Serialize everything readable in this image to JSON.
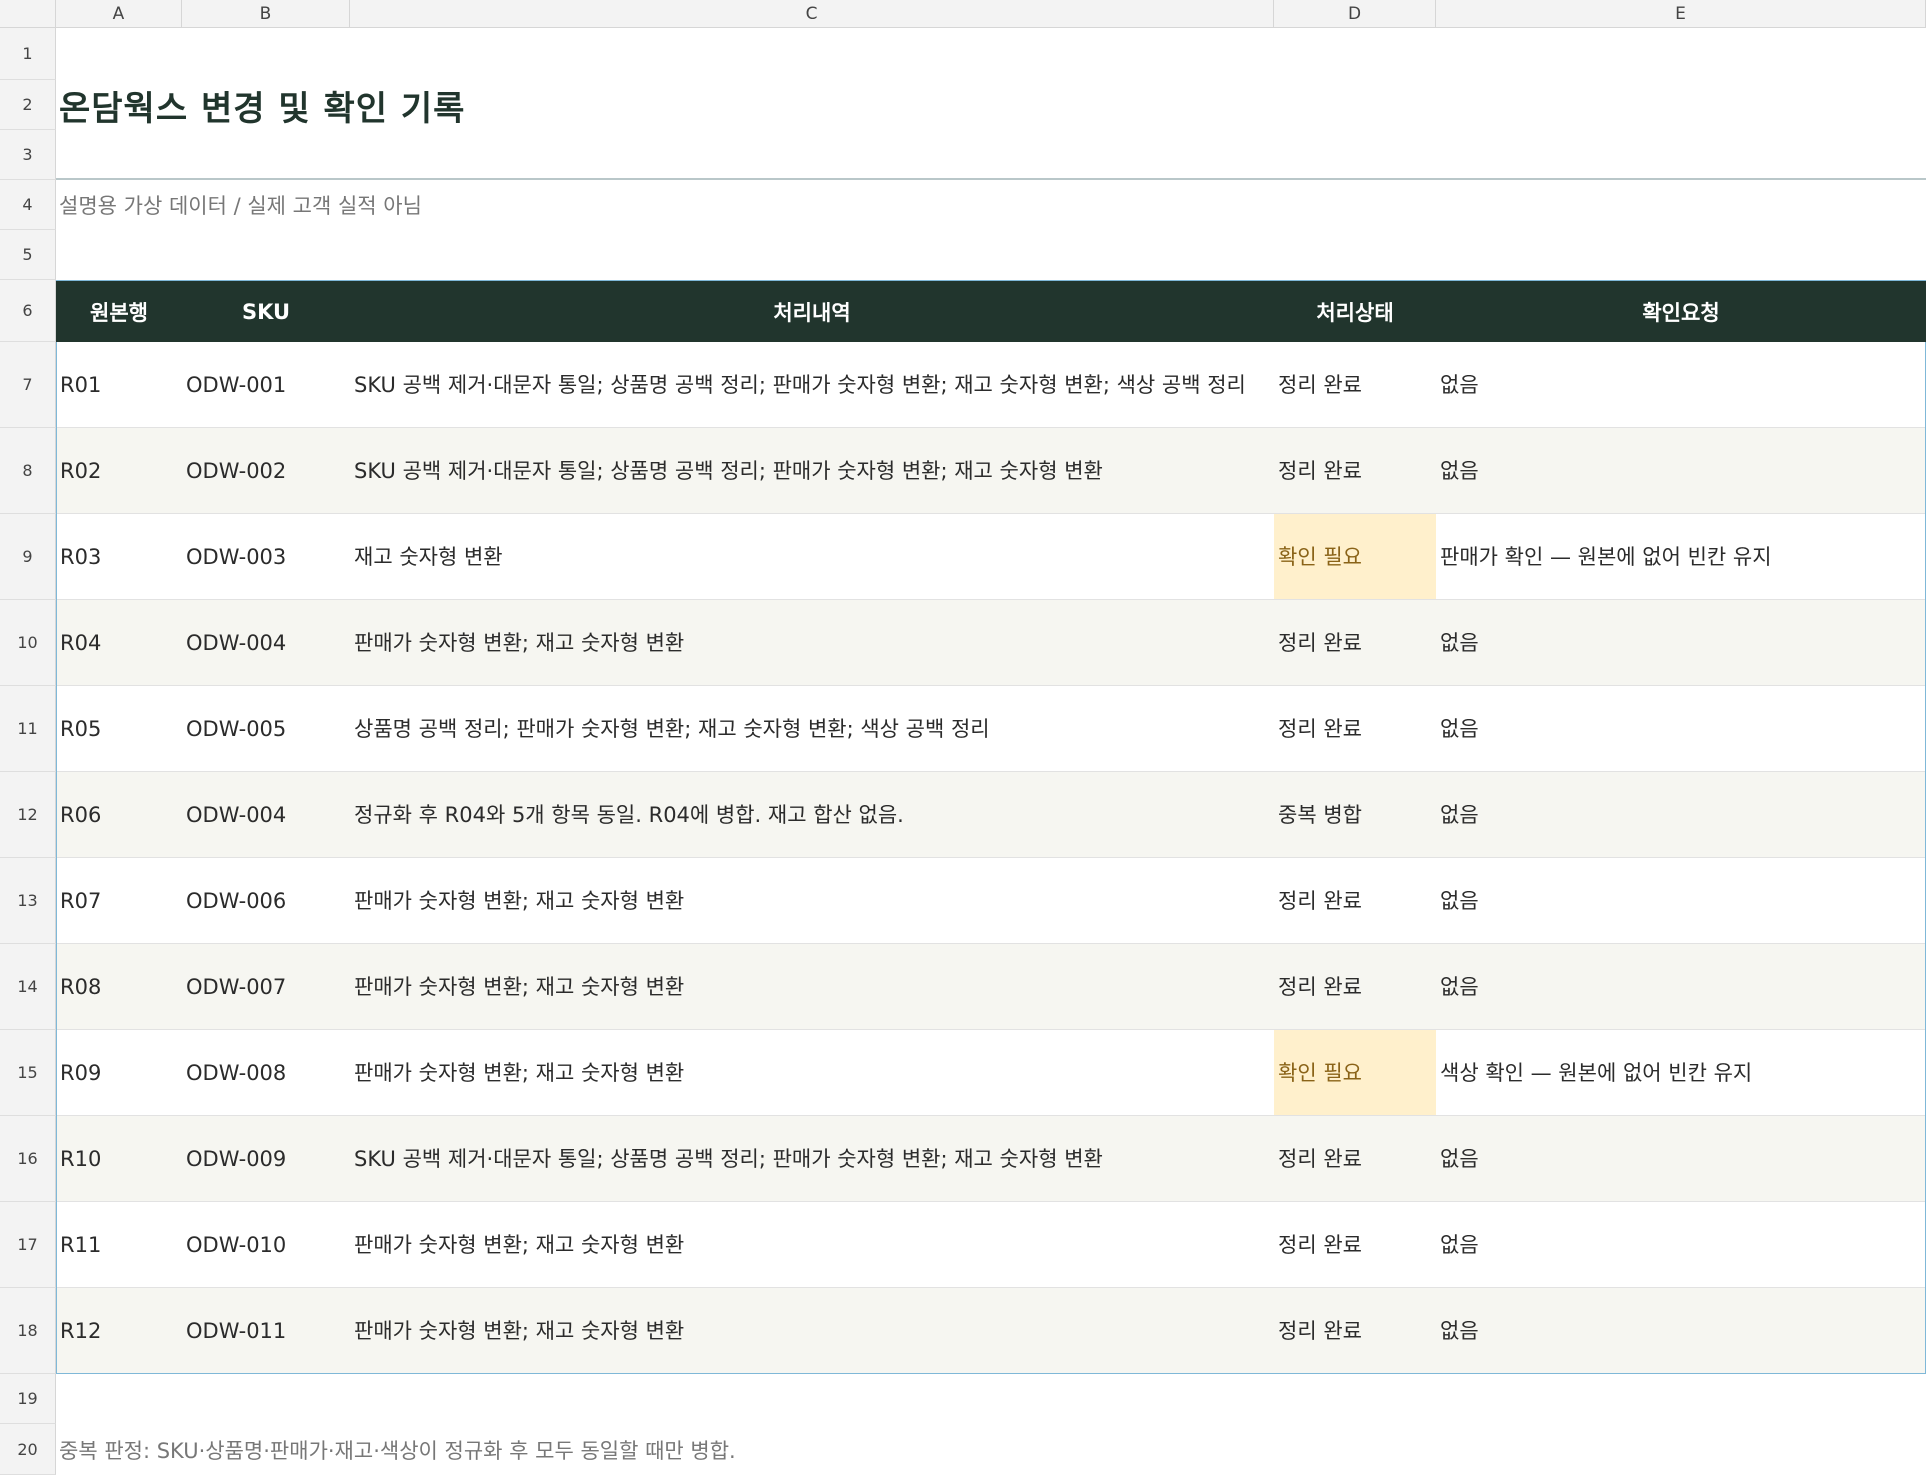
{
  "sheet": {
    "columns": [
      "A",
      "B",
      "C",
      "D",
      "E"
    ],
    "row_numbers": [
      "1",
      "2",
      "3",
      "4",
      "5",
      "6",
      "7",
      "8",
      "9",
      "10",
      "11",
      "12",
      "13",
      "14",
      "15",
      "16",
      "17",
      "18",
      "19",
      "20"
    ],
    "title": "온담웍스  변경 및 확인 기록",
    "subtitle": "설명용 가상 데이터 / 실제 고객 실적 아님",
    "footnote": "중복 판정: SKU·상품명·판매가·재고·색상이 정규화 후 모두 동일할 때만 병합."
  },
  "table": {
    "headers": [
      "원본행",
      "SKU",
      "처리내역",
      "처리상태",
      "확인요청"
    ],
    "header_bg": "#21352d",
    "warn_bg": "#fff0cc",
    "rows": [
      {
        "row": "R01",
        "sku": "ODW-001",
        "detail": "SKU 공백 제거·대문자 통일; 상품명 공백 정리; 판매가 숫자형 변환; 재고 숫자형 변환; 색상 공백 정리",
        "status": "정리 완료",
        "request": "없음"
      },
      {
        "row": "R02",
        "sku": "ODW-002",
        "detail": "SKU 공백 제거·대문자 통일; 상품명 공백 정리; 판매가 숫자형 변환; 재고 숫자형 변환",
        "status": "정리 완료",
        "request": "없음"
      },
      {
        "row": "R03",
        "sku": "ODW-003",
        "detail": "재고 숫자형 변환",
        "status": "확인 필요",
        "request": "판매가 확인 — 원본에 없어 빈칸 유지"
      },
      {
        "row": "R04",
        "sku": "ODW-004",
        "detail": "판매가 숫자형 변환; 재고 숫자형 변환",
        "status": "정리 완료",
        "request": "없음"
      },
      {
        "row": "R05",
        "sku": "ODW-005",
        "detail": "상품명 공백 정리; 판매가 숫자형 변환; 재고 숫자형 변환; 색상 공백 정리",
        "status": "정리 완료",
        "request": "없음"
      },
      {
        "row": "R06",
        "sku": "ODW-004",
        "detail": "정규화 후 R04와 5개 항목 동일. R04에 병합. 재고 합산 없음.",
        "status": "중복 병합",
        "request": "없음"
      },
      {
        "row": "R07",
        "sku": "ODW-006",
        "detail": "판매가 숫자형 변환; 재고 숫자형 변환",
        "status": "정리 완료",
        "request": "없음"
      },
      {
        "row": "R08",
        "sku": "ODW-007",
        "detail": "판매가 숫자형 변환; 재고 숫자형 변환",
        "status": "정리 완료",
        "request": "없음"
      },
      {
        "row": "R09",
        "sku": "ODW-008",
        "detail": "판매가 숫자형 변환; 재고 숫자형 변환",
        "status": "확인 필요",
        "request": "색상 확인 — 원본에 없어 빈칸 유지"
      },
      {
        "row": "R10",
        "sku": "ODW-009",
        "detail": "SKU 공백 제거·대문자 통일; 상품명 공백 정리; 판매가 숫자형 변환; 재고 숫자형 변환",
        "status": "정리 완료",
        "request": "없음"
      },
      {
        "row": "R11",
        "sku": "ODW-010",
        "detail": "판매가 숫자형 변환; 재고 숫자형 변환",
        "status": "정리 완료",
        "request": "없음"
      },
      {
        "row": "R12",
        "sku": "ODW-011",
        "detail": "판매가 숫자형 변환; 재고 숫자형 변환",
        "status": "정리 완료",
        "request": "없음"
      }
    ]
  }
}
